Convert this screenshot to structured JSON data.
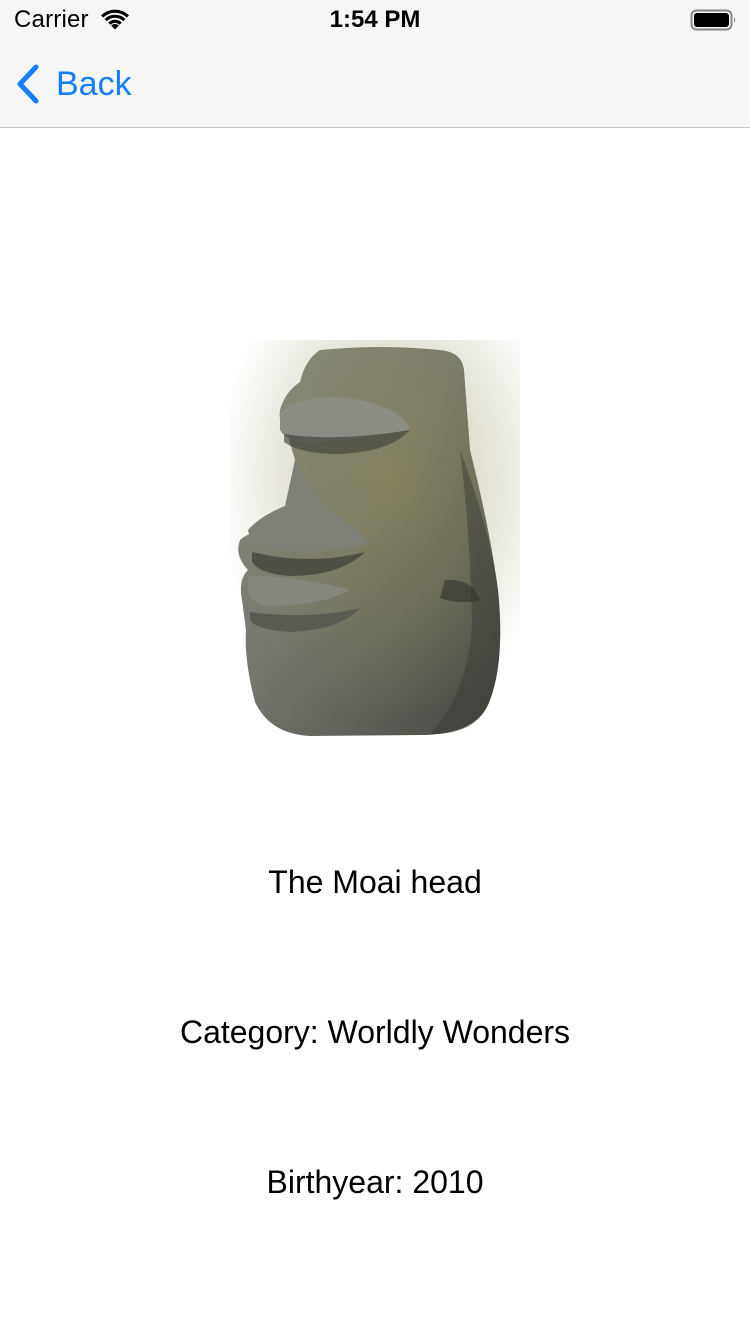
{
  "status_bar": {
    "carrier": "Carrier",
    "time": "1:54 PM",
    "icons": [
      "wifi-icon",
      "battery-icon"
    ]
  },
  "nav_bar": {
    "back_label": "Back",
    "back_icon": "chevron-left-icon",
    "accent_color": "#147efb"
  },
  "detail": {
    "image": "moai-head-emoji",
    "name": "The Moai head",
    "category": "Category: Worldly Wonders",
    "birthyear": "Birthyear: 2010"
  }
}
